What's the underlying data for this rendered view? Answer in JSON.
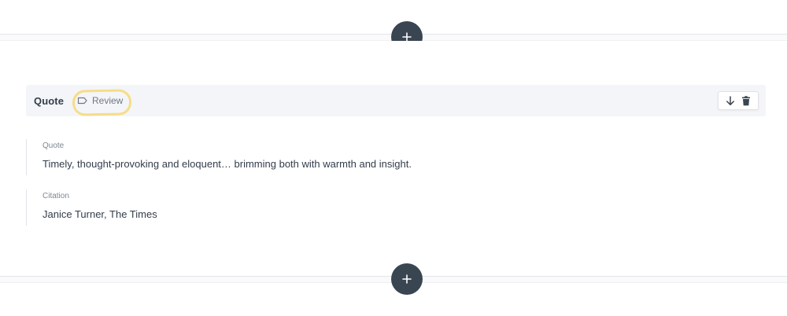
{
  "block": {
    "title": "Quote",
    "tag": "Review"
  },
  "fields": {
    "quote": {
      "label": "Quote",
      "value": "Timely, thought-provoking and eloquent… brimming both with warmth and insight."
    },
    "citation": {
      "label": "Citation",
      "value": "Janice Turner, The Times"
    }
  },
  "icons": {
    "add": "plus-icon",
    "tag": "tag-icon",
    "move_down": "arrow-down-icon",
    "delete": "trash-icon"
  },
  "colors": {
    "add_button": "#3a4552",
    "highlight": "#f6dd86",
    "header_bg": "#f4f5f8"
  }
}
